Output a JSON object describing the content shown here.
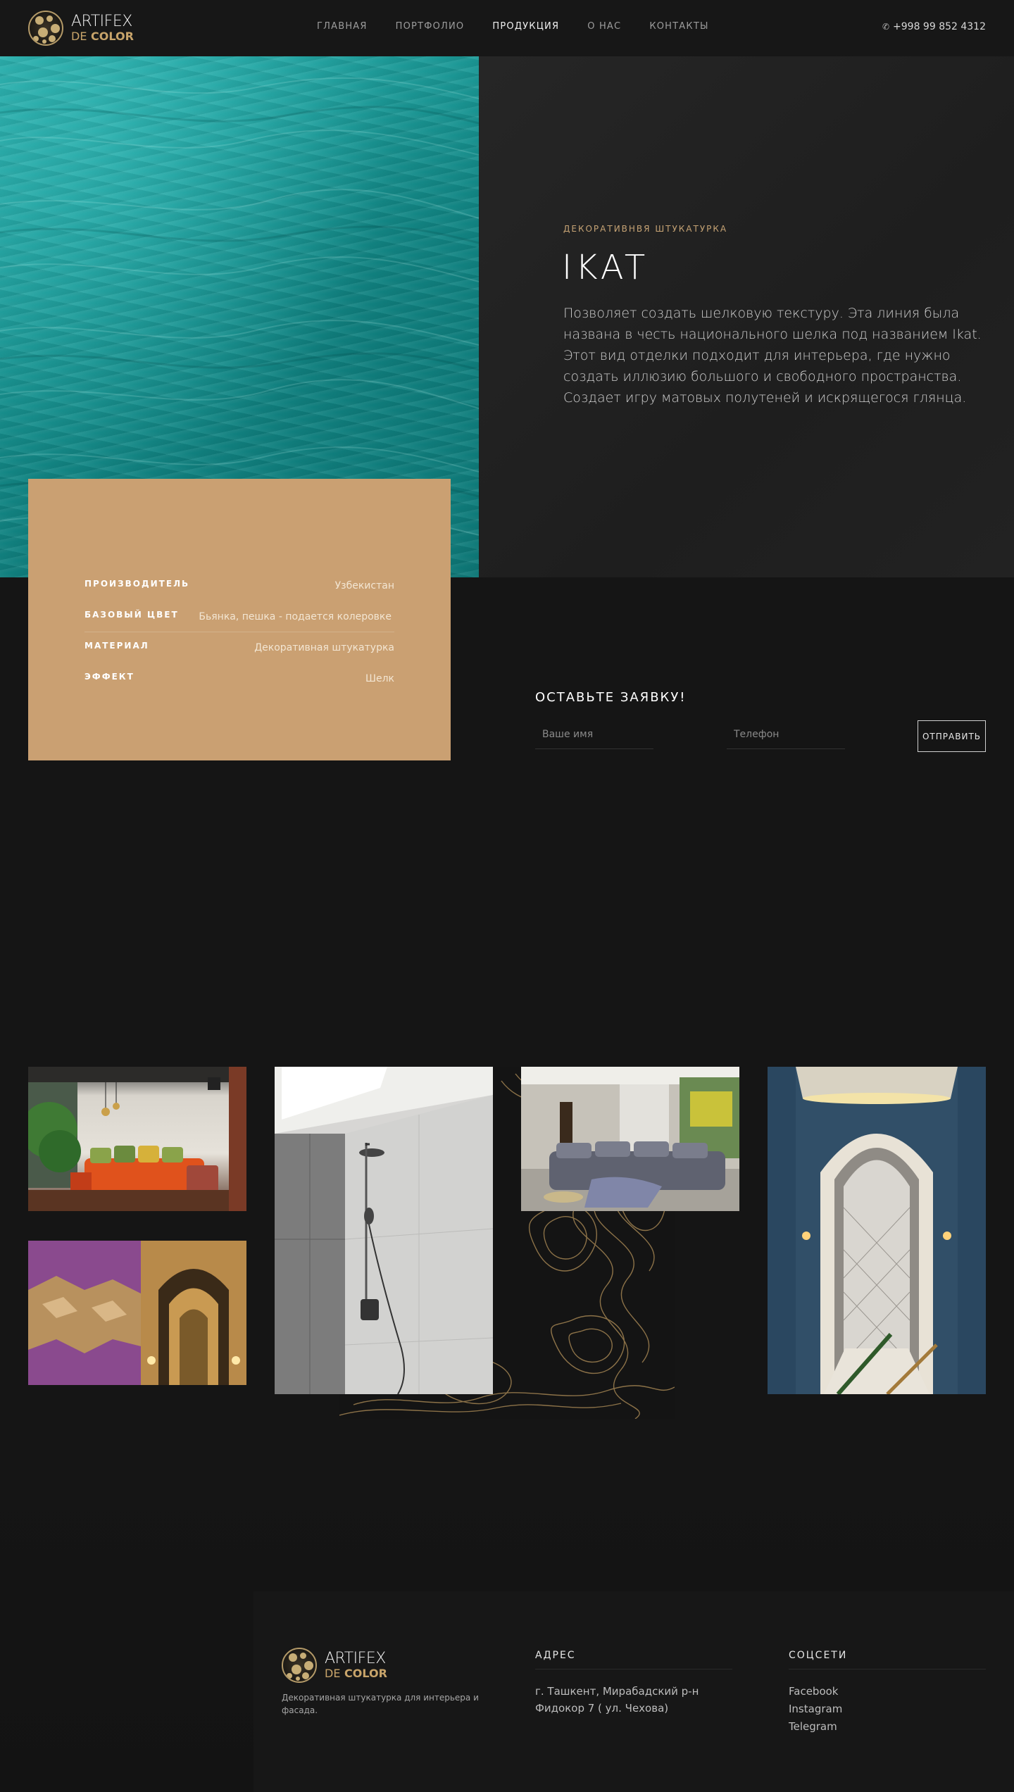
{
  "brand": {
    "line1": "ARTIFEX",
    "line2_de": "DE",
    "line2_color": "COLOR"
  },
  "nav": [
    {
      "label": "ГЛАВНАЯ"
    },
    {
      "label": "ПОРТФОЛИО"
    },
    {
      "label": "ПРОДУКЦИЯ",
      "active": true
    },
    {
      "label": "О НАС"
    },
    {
      "label": "КОНТАКТЫ"
    }
  ],
  "phone": "+998 99 852 4312",
  "hero": {
    "kicker": "ДЕКОРАТИВНВЯ ШТУКАТУРКА",
    "title": "IKAT",
    "description": "Позволяет создать шелковую текстуру. Эта линия была названа в честь национального шелка под названием Ikat. Этот вид отделки подходит для интерьера, где нужно создать иллюзию большого и свободного пространства. Создает игру матовых полутеней и искрящегося глянца."
  },
  "specs": [
    {
      "key": "ПРОИЗВОДИТЕЛЬ",
      "value": "Узбекистан"
    },
    {
      "key": "БАЗОВЫЙ ЦВЕТ",
      "value": "Бьянка, пешка - подается колеровке"
    },
    {
      "key": "МАТЕРИАЛ",
      "value": "Декоративная штукатурка"
    },
    {
      "key": "ЭФФЕКТ",
      "value": "Шелк"
    }
  ],
  "form": {
    "title": "ОСТАВЬТЕ ЗАЯВКУ!",
    "name_placeholder": "Ваше имя",
    "phone_placeholder": "Телефон",
    "submit": "ОТПРАВИТЬ"
  },
  "footer": {
    "description": "Декоративная штукатурка для интерьера и фасада.",
    "address_heading": "АДРЕС",
    "address_line1": "г. Ташкент, Мирабадский р-н",
    "address_line2": "Фидокор 7 ( ул. Чехова)",
    "social_heading": "СОЦСЕТИ",
    "social": [
      "Facebook",
      "Instagram",
      "Telegram"
    ]
  },
  "colors": {
    "accent": "#c6a374",
    "card": "#caa072",
    "background": "#151515",
    "teal": "#1a9896"
  }
}
